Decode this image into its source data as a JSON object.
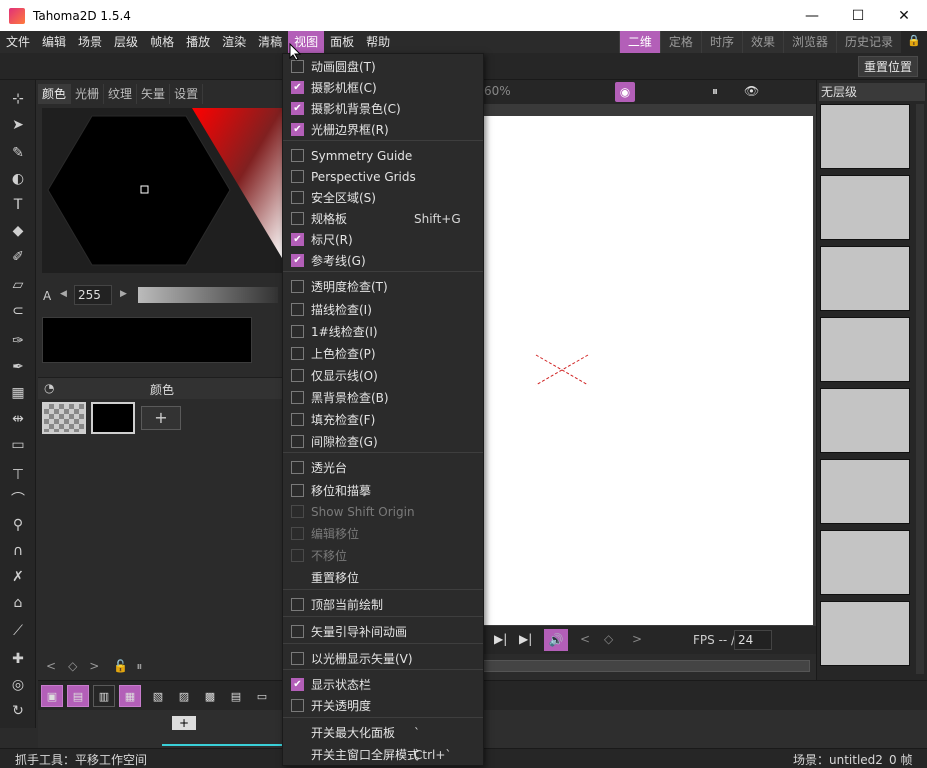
{
  "window": {
    "title": "Tahoma2D 1.5.4"
  },
  "menubar": [
    "文件",
    "编辑",
    "场景",
    "层级",
    "帧格",
    "播放",
    "渲染",
    "清稿",
    "视图",
    "面板",
    "帮助"
  ],
  "active_menu": "视图",
  "rooms": [
    "二维",
    "定格",
    "时序",
    "效果",
    "浏览器",
    "历史记录"
  ],
  "active_room": "二维",
  "toolbar": {
    "reset_position": "重置位置"
  },
  "style_panel": {
    "tabs": [
      "颜色",
      "光栅",
      "纹理",
      "矢量",
      "设置"
    ],
    "alpha_label": "A",
    "alpha_value": "255",
    "palette_title": "颜色"
  },
  "viewer": {
    "zoom": "60%",
    "fps_label": "FPS -- /",
    "fps_value": "24"
  },
  "level_strip": {
    "level_name": "无层级"
  },
  "status": {
    "tool_hint": "抓手工具：平移工作空间",
    "scene": "场景：untitled2",
    "frame": "0 帧"
  },
  "view_menu": {
    "items": [
      {
        "label": "动画圆盘(T)",
        "checkbox": true,
        "checked": false
      },
      {
        "label": "摄影机框(C)",
        "checkbox": true,
        "checked": true
      },
      {
        "label": "摄影机背景色(C)",
        "checkbox": true,
        "checked": true
      },
      {
        "label": "光栅边界框(R)",
        "checkbox": true,
        "checked": true
      },
      {
        "label": "Symmetry Guide",
        "checkbox": true,
        "checked": false
      },
      {
        "label": "Perspective Grids",
        "checkbox": true,
        "checked": false
      },
      {
        "label": "安全区域(S)",
        "checkbox": true,
        "checked": false
      },
      {
        "label": "规格板",
        "checkbox": true,
        "checked": false,
        "shortcut": "Shift+G"
      },
      {
        "label": "标尺(R)",
        "checkbox": true,
        "checked": true
      },
      {
        "label": "参考线(G)",
        "checkbox": true,
        "checked": true
      },
      {
        "label": "透明度检查(T)",
        "checkbox": true,
        "checked": false
      },
      {
        "label": "描线检查(I)",
        "checkbox": true,
        "checked": false
      },
      {
        "label": "1#线检查(I)",
        "checkbox": true,
        "checked": false
      },
      {
        "label": "上色检查(P)",
        "checkbox": true,
        "checked": false
      },
      {
        "label": "仅显示线(O)",
        "checkbox": true,
        "checked": false
      },
      {
        "label": "黑背景检查(B)",
        "checkbox": true,
        "checked": false
      },
      {
        "label": "填充检查(F)",
        "checkbox": true,
        "checked": false
      },
      {
        "label": "间隙检查(G)",
        "checkbox": true,
        "checked": false
      },
      {
        "label": "透光台",
        "checkbox": true,
        "checked": false
      },
      {
        "label": "移位和描摹",
        "checkbox": true,
        "checked": false
      },
      {
        "label": "Show Shift Origin",
        "checkbox": true,
        "checked": false,
        "disabled": true
      },
      {
        "label": "编辑移位",
        "checkbox": true,
        "checked": false,
        "disabled": true
      },
      {
        "label": "不移位",
        "checkbox": true,
        "checked": false,
        "disabled": true
      },
      {
        "label": "重置移位",
        "checkbox": false
      },
      {
        "label": "顶部当前绘制",
        "checkbox": true,
        "checked": false
      },
      {
        "label": "矢量引导补间动画",
        "checkbox": true,
        "checked": false
      },
      {
        "label": "以光栅显示矢量(V)",
        "checkbox": true,
        "checked": false
      },
      {
        "label": "显示状态栏",
        "checkbox": true,
        "checked": true
      },
      {
        "label": "开关透明度",
        "checkbox": true,
        "checked": false
      },
      {
        "label": "开关最大化面板",
        "checkbox": false,
        "shortcut": "`"
      },
      {
        "label": "开关主窗口全屏模式",
        "checkbox": false,
        "shortcut": "Ctrl+`"
      }
    ]
  },
  "colors": {
    "accent": "#b35fb8",
    "panel": "#2b2b2b",
    "canvas": "#ffffff"
  }
}
